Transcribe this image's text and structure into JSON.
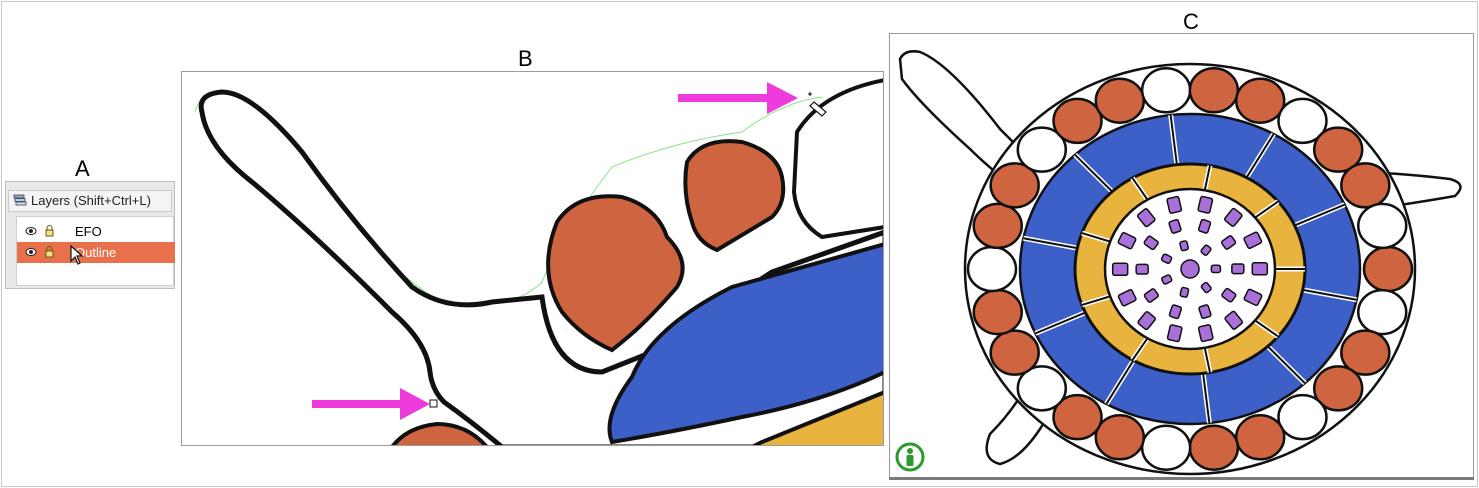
{
  "panels": {
    "a": {
      "label": "A"
    },
    "b": {
      "label": "B"
    },
    "c": {
      "label": "C"
    }
  },
  "layers_dialog": {
    "title": "Layers (Shift+Ctrl+L)",
    "layers": [
      {
        "name": "EFO",
        "selected": false
      },
      {
        "name": "Outline",
        "selected": true
      }
    ]
  },
  "colors": {
    "orange_cell": "#cf6540",
    "blue_cell": "#3d5fc8",
    "yellow_cell": "#e8b43e",
    "purple_cell": "#a870d8",
    "arrow": "#f03bdc",
    "selection": "#e8714c",
    "info_icon": "#2c9a2c"
  },
  "icons": [
    "layers-icon",
    "eye-icon",
    "lock-icon",
    "mouse-cursor-icon",
    "arrow-icon",
    "pen-tool-icon",
    "node-handle-icon",
    "info-person-icon"
  ]
}
